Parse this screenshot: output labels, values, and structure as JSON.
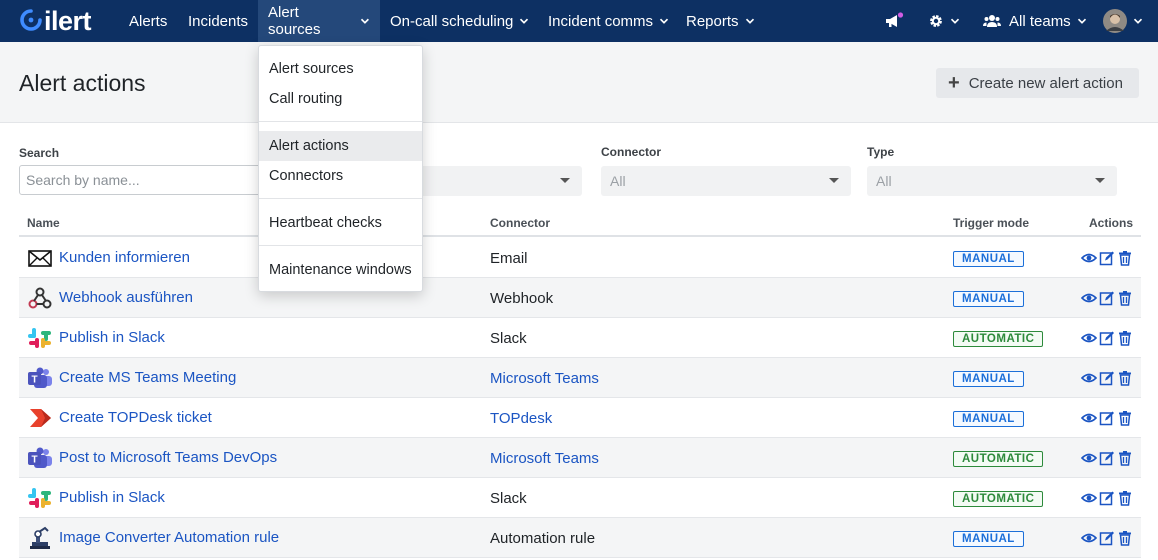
{
  "brand": {
    "logo_text": "ilert",
    "accent": "#0d3063",
    "link_color": "#1b55c3"
  },
  "nav": {
    "items": [
      {
        "label": "Alerts",
        "dropdown": false
      },
      {
        "label": "Incidents",
        "dropdown": false
      },
      {
        "label": "Alert sources",
        "dropdown": true,
        "active": true
      },
      {
        "label": "On-call scheduling",
        "dropdown": true
      },
      {
        "label": "Incident comms",
        "dropdown": true
      },
      {
        "label": "Reports",
        "dropdown": true
      }
    ],
    "teams_label": "All teams"
  },
  "dropdown": {
    "items": [
      {
        "label": "Alert sources"
      },
      {
        "label": "Call routing"
      },
      {
        "label": "Alert actions",
        "active": true
      },
      {
        "label": "Connectors"
      },
      {
        "label": "Heartbeat checks"
      },
      {
        "label": "Maintenance windows"
      }
    ]
  },
  "page": {
    "title": "Alert actions",
    "create_button": "Create new alert action"
  },
  "filters": {
    "search_label": "Search",
    "search_placeholder": "Search by name...",
    "connector_label": "Connector",
    "connector_value": "All",
    "type_label": "Type",
    "type_value": "All"
  },
  "table": {
    "columns": {
      "name": "Name",
      "connector": "Connector",
      "trigger": "Trigger mode",
      "actions": "Actions"
    },
    "rows": [
      {
        "name": "Kunden informieren",
        "connector": "Email",
        "connector_link": false,
        "trigger": "MANUAL",
        "icon": "email-icon"
      },
      {
        "name": "Webhook ausführen",
        "connector": "Webhook",
        "connector_link": false,
        "trigger": "MANUAL",
        "icon": "webhook-icon"
      },
      {
        "name": "Publish in Slack",
        "connector": "Slack",
        "connector_link": false,
        "trigger": "AUTOMATIC",
        "icon": "slack-icon"
      },
      {
        "name": "Create MS Teams Meeting",
        "connector": "Microsoft Teams",
        "connector_link": true,
        "trigger": "MANUAL",
        "icon": "teams-icon"
      },
      {
        "name": "Create TOPDesk ticket",
        "connector": "TOPdesk",
        "connector_link": true,
        "trigger": "MANUAL",
        "icon": "topdesk-icon"
      },
      {
        "name": "Post to Microsoft Teams DevOps",
        "connector": "Microsoft Teams",
        "connector_link": true,
        "trigger": "AUTOMATIC",
        "icon": "teams-icon"
      },
      {
        "name": "Publish in Slack",
        "connector": "Slack",
        "connector_link": false,
        "trigger": "AUTOMATIC",
        "icon": "slack-icon"
      },
      {
        "name": "Image Converter Automation rule",
        "connector": "Automation rule",
        "connector_link": false,
        "trigger": "MANUAL",
        "icon": "automation-icon"
      }
    ]
  }
}
